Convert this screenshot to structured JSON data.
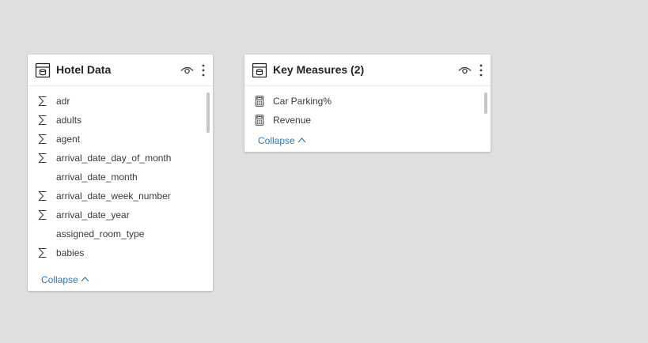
{
  "colors": {
    "canvas_background": "#e0dfdd",
    "card_background": "#ffffff",
    "link": "#2a7ab8",
    "text": "#3b3a39",
    "title": "#252423"
  },
  "tables": [
    {
      "title": "Hotel Data",
      "icon": "table-icon",
      "fields": [
        {
          "label": "adr",
          "icon": "sigma-icon"
        },
        {
          "label": "adults",
          "icon": "sigma-icon"
        },
        {
          "label": "agent",
          "icon": "sigma-icon"
        },
        {
          "label": "arrival_date_day_of_month",
          "icon": "sigma-icon"
        },
        {
          "label": "arrival_date_month",
          "icon": ""
        },
        {
          "label": "arrival_date_week_number",
          "icon": "sigma-icon"
        },
        {
          "label": "arrival_date_year",
          "icon": "sigma-icon"
        },
        {
          "label": "assigned_room_type",
          "icon": ""
        },
        {
          "label": "babies",
          "icon": "sigma-icon"
        }
      ],
      "collapse_label": "Collapse"
    },
    {
      "title": "Key Measures (2)",
      "icon": "table-icon",
      "fields": [
        {
          "label": "Car Parking%",
          "icon": "calculator-icon"
        },
        {
          "label": "Revenue",
          "icon": "calculator-icon"
        }
      ],
      "collapse_label": "Collapse"
    }
  ]
}
